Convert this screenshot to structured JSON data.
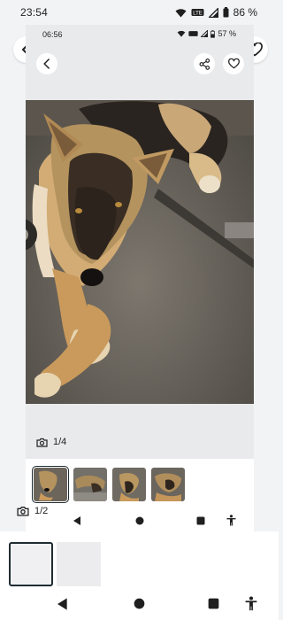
{
  "status_outer": {
    "time": "23:54",
    "battery": "86 %"
  },
  "status_inner": {
    "time": "06:56",
    "battery": "57 %"
  },
  "photo_counter": "1/4",
  "gallery_counter": "1/2",
  "icons": {
    "back": "back-arrow-icon",
    "share": "share-icon",
    "favorite": "heart-icon",
    "camera": "camera-icon",
    "nav_back": "triangle-back-icon",
    "nav_home": "circle-home-icon",
    "nav_recents": "square-recents-icon",
    "accessibility": "accessibility-icon"
  },
  "colors": {
    "background": "#f2f3f5",
    "panel": "#ffffff",
    "selected_outline": "#1f2d33"
  }
}
